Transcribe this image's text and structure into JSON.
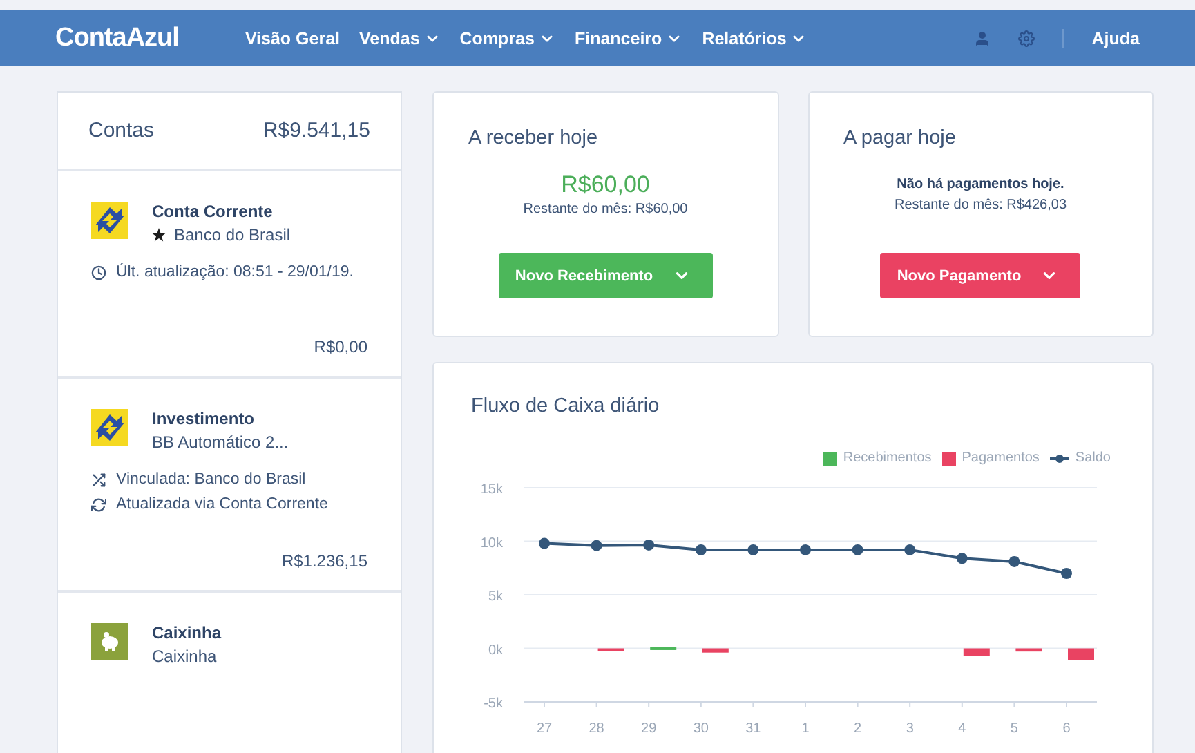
{
  "header": {
    "logo": "ContaAzul",
    "nav": [
      {
        "label": "Visão Geral",
        "has_menu": false
      },
      {
        "label": "Vendas",
        "has_menu": true
      },
      {
        "label": "Compras",
        "has_menu": true
      },
      {
        "label": "Financeiro",
        "has_menu": true
      },
      {
        "label": "Relatórios",
        "has_menu": true
      }
    ],
    "help": "Ajuda"
  },
  "accounts": {
    "title": "Contas",
    "total": "R$9.541,15",
    "items": [
      {
        "kind": "bank",
        "name": "Conta Corrente",
        "subtitle": "Banco do Brasil",
        "favorite": true,
        "details": [
          {
            "kind": "clock",
            "text": "Últ. atualização: 08:51 - 29/01/19."
          }
        ],
        "balance": "R$0,00"
      },
      {
        "kind": "bank",
        "name": "Investimento",
        "subtitle": "BB Automático 2...",
        "favorite": false,
        "details": [
          {
            "kind": "link",
            "text": "Vinculada: Banco do Brasil"
          },
          {
            "kind": "sync",
            "text": "Atualizada via Conta Corrente"
          }
        ],
        "balance": "R$1.236,15"
      },
      {
        "kind": "piggy",
        "name": "Caixinha",
        "subtitle": "Caixinha",
        "favorite": false
      }
    ]
  },
  "summary": [
    {
      "kind": "receive",
      "title": "A receber hoje",
      "amount": "R$60,00",
      "remaining": "Restante do mês: R$60,00",
      "button": "Novo Recebimento"
    },
    {
      "kind": "pay",
      "title": "A pagar hoje",
      "message": "Não há pagamentos hoje.",
      "remaining": "Restante do mês: R$426,03",
      "button": "Novo Pagamento"
    }
  ],
  "cashflow": {
    "title": "Fluxo de Caixa diário",
    "chart_data": {
      "type": "bar",
      "categories": [
        "27",
        "28",
        "29",
        "30",
        "31",
        "1",
        "2",
        "3",
        "4",
        "5",
        "6"
      ],
      "series": [
        {
          "name": "Recebimentos",
          "color": "#4cb75a",
          "values": [
            0,
            0,
            100,
            0,
            0,
            0,
            0,
            0,
            0,
            0,
            0
          ]
        },
        {
          "name": "Pagamentos",
          "color": "#e94362",
          "values": [
            0,
            -200,
            0,
            -400,
            0,
            0,
            0,
            0,
            -700,
            -300,
            -1100
          ]
        },
        {
          "name": "Saldo",
          "color": "#34577a",
          "type": "line",
          "marker": "circle",
          "values": [
            9800,
            9600,
            9650,
            9200,
            9200,
            9200,
            9200,
            9200,
            8400,
            8100,
            7000
          ]
        }
      ],
      "stacked": true,
      "grid": true,
      "legend": "top-right",
      "ylim": [
        -5000,
        15000
      ],
      "yticks": [
        {
          "value": 15000,
          "label": "15k"
        },
        {
          "value": 10000,
          "label": "10k"
        },
        {
          "value": 5000,
          "label": "5k"
        },
        {
          "value": 0,
          "label": "0k"
        },
        {
          "value": -5000,
          "label": "-5k"
        }
      ]
    }
  }
}
